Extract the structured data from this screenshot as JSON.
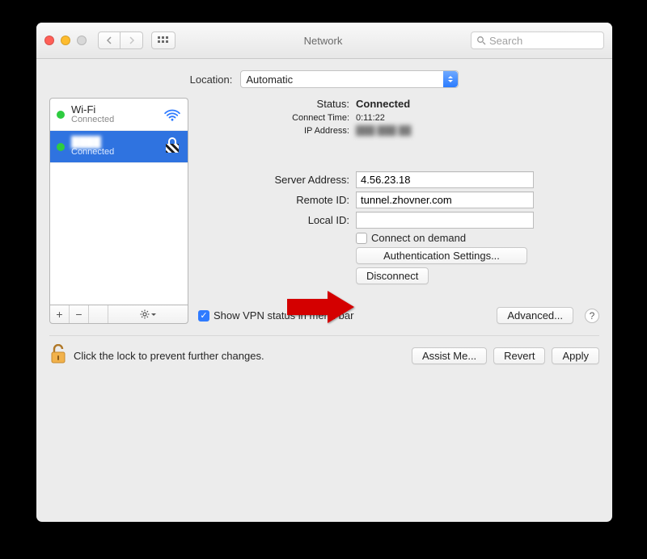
{
  "window": {
    "title": "Network",
    "search_placeholder": "Search"
  },
  "location": {
    "label": "Location:",
    "value": "Automatic"
  },
  "sidebar": {
    "items": [
      {
        "name": "Wi-Fi",
        "sub": "Connected",
        "status": "green",
        "icon": "wifi",
        "selected": false
      },
      {
        "name": "████",
        "sub": "Connected",
        "status": "green",
        "icon": "vpn",
        "selected": true
      }
    ],
    "tools": {
      "add": "+",
      "remove": "−",
      "spacer": " "
    }
  },
  "detail": {
    "status_label": "Status:",
    "status_value": "Connected",
    "connect_time_label": "Connect Time:",
    "connect_time_value": "0:11:22",
    "ip_label": "IP Address:",
    "ip_value": "███ ███ ██",
    "server_addr_label": "Server Address:",
    "server_addr_value": "4.56.23.18",
    "remote_id_label": "Remote ID:",
    "remote_id_value": "tunnel.zhovner.com",
    "local_id_label": "Local ID:",
    "local_id_value": "",
    "connect_on_demand_label": "Connect on demand",
    "auth_settings_label": "Authentication Settings...",
    "disconnect_label": "Disconnect",
    "show_status_label": "Show VPN status in menu bar",
    "show_status_checked": true,
    "advanced_label": "Advanced..."
  },
  "footer": {
    "lock_text": "Click the lock to prevent further changes.",
    "assist": "Assist Me...",
    "revert": "Revert",
    "apply": "Apply"
  }
}
